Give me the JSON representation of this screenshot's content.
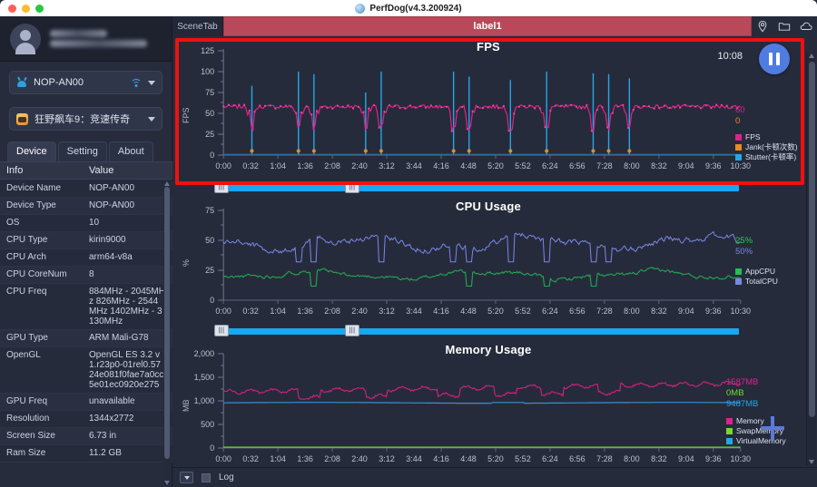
{
  "window": {
    "title": "PerfDog(v4.3.200924)",
    "app_icon": "perfdog-logo-icon"
  },
  "sidebar": {
    "device_selector": {
      "label": "NOP-AN00",
      "icon": "android-icon",
      "status_icon": "wifi-icon"
    },
    "app_selector": {
      "label": "狂野飙车9：竞速传奇",
      "icon": "game-app-icon"
    },
    "tabs": [
      {
        "label": "Device",
        "active": true
      },
      {
        "label": "Setting",
        "active": false
      },
      {
        "label": "About",
        "active": false
      }
    ],
    "table": {
      "headers": {
        "key": "Info",
        "value": "Value"
      },
      "rows": [
        {
          "key": "Device Name",
          "value": "NOP-AN00"
        },
        {
          "key": "Device Type",
          "value": "NOP-AN00"
        },
        {
          "key": "OS",
          "value": "10"
        },
        {
          "key": "CPU Type",
          "value": "kirin9000"
        },
        {
          "key": "CPU Arch",
          "value": "arm64-v8a"
        },
        {
          "key": "CPU CoreNum",
          "value": "8"
        },
        {
          "key": "CPU Freq",
          "value": "884MHz - 2045MHz 826MHz - 2544MHz 1402MHz - 3130MHz"
        },
        {
          "key": "GPU Type",
          "value": "ARM Mali-G78"
        },
        {
          "key": "OpenGL",
          "value": "OpenGL ES 3.2 v1.r23p0-01rel0.5724e081f0fae7a0cc5e01ec0920e275"
        },
        {
          "key": "GPU Freq",
          "value": "unavailable"
        },
        {
          "key": "Resolution",
          "value": "1344x2772"
        },
        {
          "key": "Screen Size",
          "value": "6.73 in"
        },
        {
          "key": "Ram Size",
          "value": "11.2 GB"
        }
      ]
    }
  },
  "scenebar": {
    "scene_tab_label": "SceneTab",
    "active_label": "label1",
    "icons": [
      "location-pin-icon",
      "folder-icon",
      "cloud-icon"
    ]
  },
  "recording": {
    "elapsed": "10:08",
    "pause_label": "pause-button"
  },
  "bottom": {
    "log_label": "Log"
  },
  "chart_data": [
    {
      "type": "line",
      "title": "FPS",
      "ylabel": "FPS",
      "xlabel": "",
      "ylim": [
        0,
        125
      ],
      "yticks": [
        0,
        25,
        50,
        75,
        100,
        125
      ],
      "xticks": [
        "0:00",
        "0:32",
        "1:04",
        "1:36",
        "2:08",
        "2:40",
        "3:12",
        "3:44",
        "4:16",
        "4:48",
        "5:20",
        "5:52",
        "6:24",
        "6:56",
        "7:28",
        "8:00",
        "8:32",
        "9:04",
        "9:36",
        "10:30"
      ],
      "grid": false,
      "legend_position": "right",
      "current_values": [
        {
          "label": "60",
          "color": "#e0218a"
        },
        {
          "label": "0",
          "color": "#e88b20"
        }
      ],
      "series": [
        {
          "name": "FPS",
          "color": "#e0218a",
          "baseline": 58,
          "noise": 3
        },
        {
          "name": "Jank(卡顿次数)",
          "color": "#e88b20",
          "baseline": 0,
          "noise": 0
        },
        {
          "name": "Stutter(卡顿率)",
          "color": "#24a7e8",
          "baseline": 0,
          "noise": 0
        }
      ],
      "spikes_stutter": [
        0.055,
        0.145,
        0.175,
        0.275,
        0.305,
        0.445,
        0.475,
        0.555,
        0.625,
        0.715,
        0.745,
        0.785
      ],
      "spike_heights": [
        83,
        100,
        97,
        75,
        100,
        100,
        94,
        90,
        100,
        98,
        97,
        92
      ]
    },
    {
      "type": "line",
      "title": "CPU Usage",
      "ylabel": "%",
      "xlabel": "",
      "ylim": [
        0,
        75
      ],
      "yticks": [
        0,
        25,
        50,
        75
      ],
      "xticks": [
        "0:00",
        "0:32",
        "1:04",
        "1:36",
        "2:08",
        "2:40",
        "3:12",
        "3:44",
        "4:16",
        "4:48",
        "5:20",
        "5:52",
        "6:24",
        "6:56",
        "7:28",
        "8:00",
        "8:32",
        "9:04",
        "9:36",
        "10:30"
      ],
      "grid": false,
      "legend_position": "right",
      "current_values": [
        {
          "label": "25%",
          "color": "#34c45a"
        },
        {
          "label": "50%",
          "color": "#7b86e8"
        }
      ],
      "series": [
        {
          "name": "AppCPU",
          "color": "#22a850",
          "baseline": 21,
          "noise": 4
        },
        {
          "name": "TotalCPU",
          "color": "#7b86e8",
          "baseline": 48,
          "noise": 6
        }
      ]
    },
    {
      "type": "line",
      "title": "Memory Usage",
      "ylabel": "MB",
      "xlabel": "",
      "ylim": [
        0,
        2000
      ],
      "yticks": [
        "0",
        "500",
        "1,000",
        "1,500",
        "2,000"
      ],
      "xticks": [
        "0:00",
        "0:32",
        "1:04",
        "1:36",
        "2:08",
        "2:40",
        "3:12",
        "3:44",
        "4:16",
        "4:48",
        "5:20",
        "5:52",
        "6:24",
        "6:56",
        "7:28",
        "8:00",
        "8:32",
        "9:04",
        "9:36",
        "10:30"
      ],
      "grid": false,
      "legend_position": "right",
      "current_values": [
        {
          "label": "1587MB",
          "color": "#e0218a"
        },
        {
          "label": "0MB",
          "color": "#6ddc36"
        },
        {
          "label": "9487MB",
          "color": "#24a7e8"
        }
      ],
      "series": [
        {
          "name": "Memory",
          "color": "#d4217f",
          "baseline": 1300,
          "noise": 90
        },
        {
          "name": "SwapMemory",
          "color": "#6ddc36",
          "baseline": 15,
          "noise": 0
        },
        {
          "name": "VirtualMemory",
          "color": "#3a8fd0",
          "baseline": 960,
          "noise": 8
        }
      ]
    }
  ],
  "colors": {
    "accent_red": "#ee1111",
    "label_bar": "#b9495a",
    "panel_bg": "#262b3b",
    "timebar": "#18a8f0",
    "pause_blue": "#4f7ce0"
  }
}
